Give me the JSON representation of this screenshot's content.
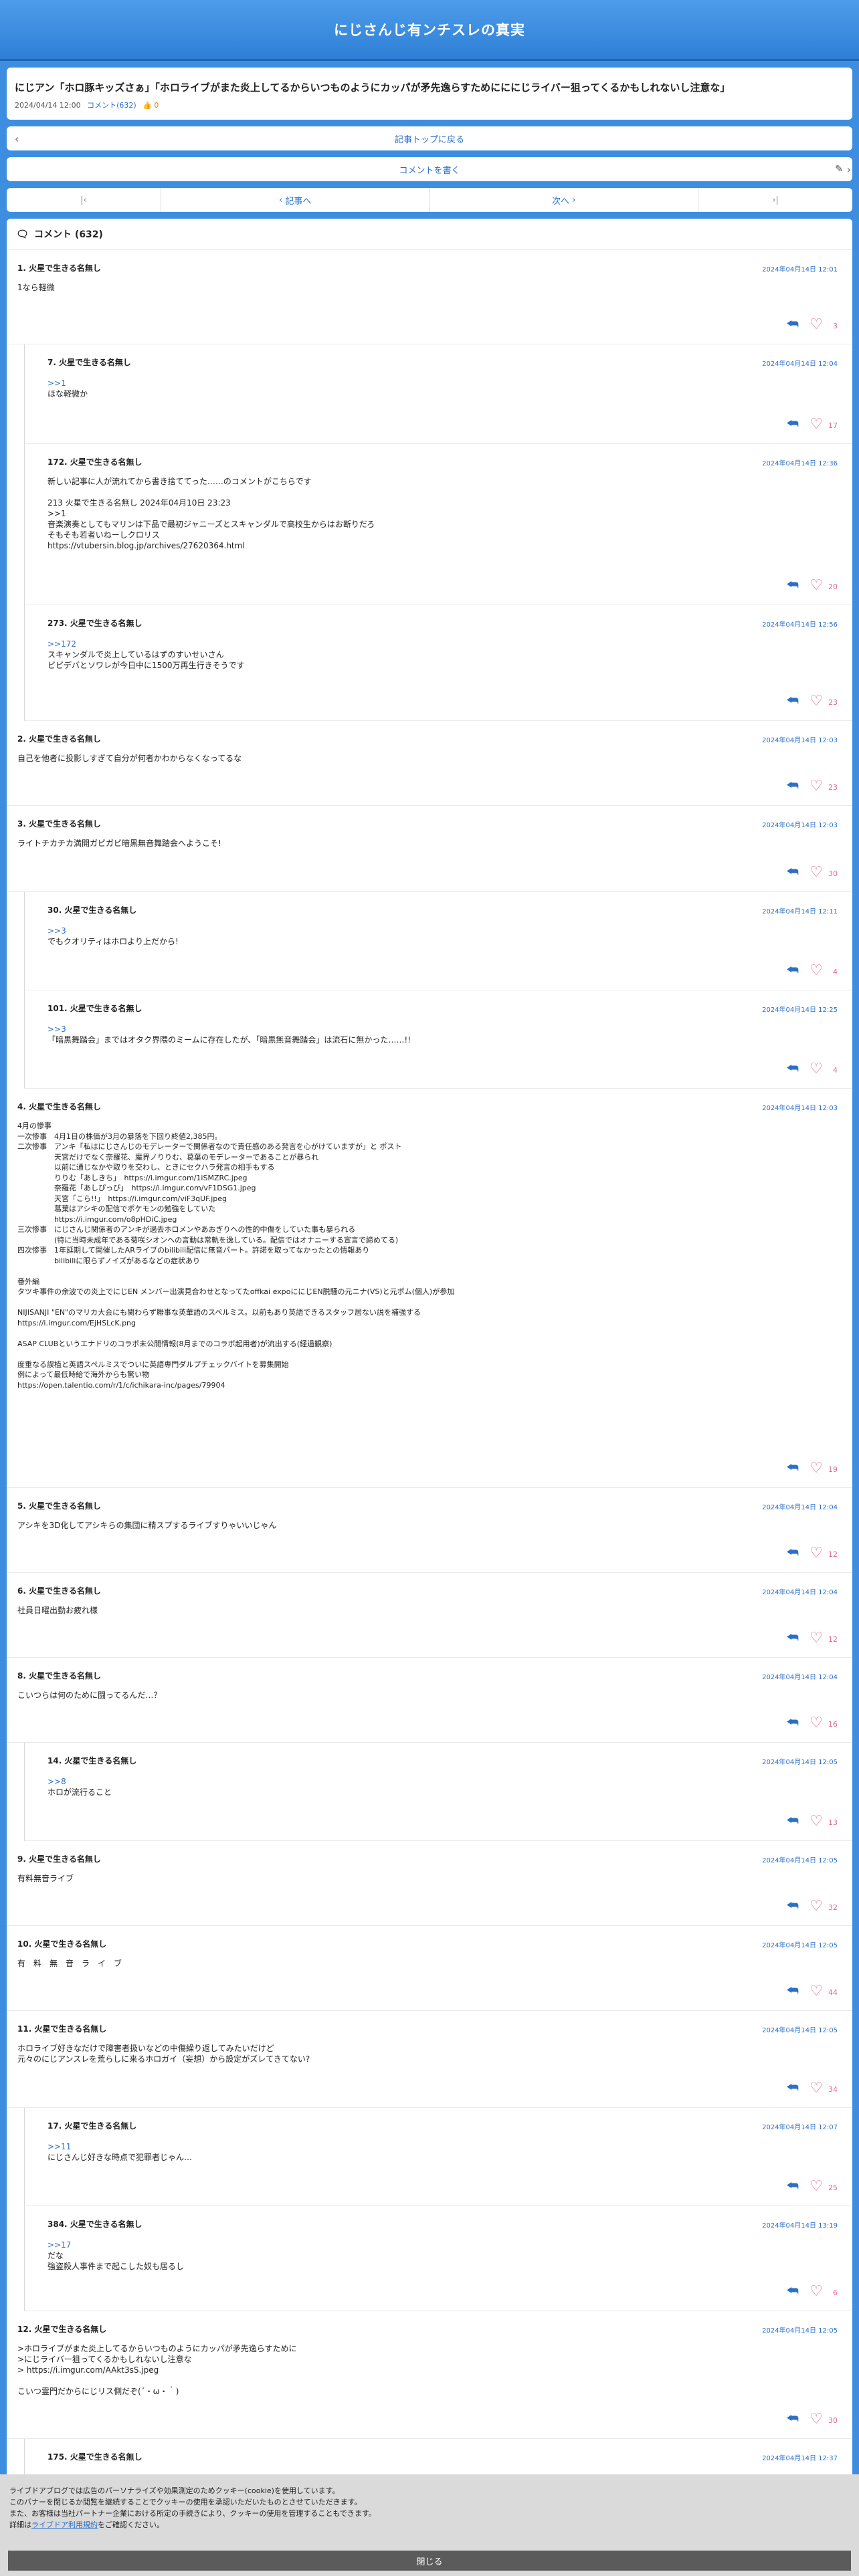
{
  "header": {
    "title": "にじさんじ有ンチスレの真実"
  },
  "article": {
    "title": "にじアン「ホロ豚キッズさぁ」「ホロライブがまた炎上してるからいつものようにカッパが矛先逸らすためにににじライバー狙ってくるかもしれないし注意な」",
    "date": "2024/04/14 12:00",
    "comments": "コメント(632)",
    "likes": "👍 0"
  },
  "nav": {
    "back": "記事トップに戻る",
    "write": "コメントを書く",
    "prev": "記事へ",
    "next": "次へ"
  },
  "comments_header": "コメント (632)",
  "comments": [
    {
      "name": "1. 火星で生きる名無し",
      "date": "2024年04月14日 12:01",
      "body": "1なら軽微",
      "count": "3"
    },
    {
      "name": "7. 火星で生きる名無し",
      "date": "2024年04月14日 12:04",
      "body_link": ">>1",
      "body": "ほな軽微か",
      "count": "17"
    },
    {
      "name": "172. 火星で生きる名無し",
      "date": "2024年04月14日 12:36",
      "body": "新しい記事に人が流れてから書き捨ててった……のコメントがこちらです\n\n213 火星で生きる名無し 2024年04月10日 23:23\n>>1\n音楽演奏としてもマリンは下品で最初ジャニーズとスキャンダルで高校生からはお断りだろ\nそもそも若者いねーしクロリス\nhttps://vtubersin.blog.jp/archives/27620364.html",
      "count": "20"
    },
    {
      "name": "273. 火星で生きる名無し",
      "date": "2024年04月14日 12:56",
      "body_link": ">>172",
      "body": "スキャンダルで炎上しているはずのすいせいさん\nビビデバとソワレが今日中に1500万再生行きそうです",
      "count": "23"
    },
    {
      "name": "2. 火星で生きる名無し",
      "date": "2024年04月14日 12:03",
      "body": "自己を他者に投影しすぎて自分が何者かわからなくなってるな",
      "count": "23"
    },
    {
      "name": "3. 火星で生きる名無し",
      "date": "2024年04月14日 12:03",
      "body": "ライトチカチカ満開ガビガビ暗黒無音舞踏会へようこそ!",
      "count": "30"
    },
    {
      "name": "30. 火星で生きる名無し",
      "date": "2024年04月14日 12:11",
      "body_link": ">>3",
      "body": "でもクオリティはホロより上だから!",
      "count": "4"
    },
    {
      "name": "101. 火星で生きる名無し",
      "date": "2024年04月14日 12:25",
      "body_link": ">>3",
      "body": "「暗黒舞踏会」まではオタク界隈のミームに存在したが、「暗黒無音舞踏会」は流石に無かった……!!",
      "count": "4"
    },
    {
      "name": "4. 火星で生きる名無し",
      "date": "2024年04月14日 12:03",
      "body": "4月の惨事\n一次惨事　4月1日の株価が3月の暴落を下回り終値2,385円。\n二次惨事　アンキ「私はにじさんじのモデレーターで関係者なので責任感のある発言を心がけていますが」と ポスト\n　　　　　天宮だけでなく奈羅花、魔界ノりりむ、葛葉のモデレーターであることが暴られ\n　　　　　以前に通じなかや取りを交わし、ときにセクハラ発言の相手もする\n　　　　　りりむ「あしきち」　https://i.imgur.com/1iSMZRC.jpeg\n　　　　　奈羅花「あしぴっぴ」　https://i.imgur.com/vF1DSG1.jpeg\n　　　　　天宮「こら!!」　https://i.imgur.com/viF3qUF.jpeg\n　　　　　葛葉はアシキの配信でポケモンの勉強をしていた\n　　　　　https://i.imgur.com/o8pHDiC.jpeg\n三次惨事　にじさんじ関係者のアンキが過去ホロメンやあおぎりへの性的中傷をしていた事も暴られる\n　　　　　(特に当時未成年である菊咲シオンへの言動は常軌を逸している。配信ではオナニーする宣言で締めてる)\n四次惨事　1年延期して開催したARライブのbilibili配信に無音パート。許諾を取ってなかったとの情報あり\n　　　　　bilibiliに限らずノイズがあるなどの症状あり\n\n番外編\nタツキ事件の余波での炎上でにじEN メンバー出演見合わせとなってたoffkai expoににじEN脱騒の元ニナ(VS)と元ポム(個人)が参加\n\nNIJISANJI \"EN\"のマリカ大会にも関わらず聯事な英華語のスペルミス。以前もあり英語できるスタッフ居ない説を補強する\nhttps://i.imgur.com/EjHSLcK.png\n\nASAP CLUBというエナドリのコラボ未公開情報(8月までのコラボ起用者)が流出する(経過観察)\n\n度重なる誤植と英語スペルミスでついに英語専門ダルプチェックバイトを募集開始\n例によって最低時給で海外からも驚い物\nhttps://open.talentio.com/r/1/c/ichikara-inc/pages/79904",
      "count": "19"
    },
    {
      "name": "5. 火星で生きる名無し",
      "date": "2024年04月14日 12:04",
      "body": "アシキを3D化してアシキらの集団に精スプするライブすりゃいいじゃん",
      "count": "12"
    },
    {
      "name": "6. 火星で生きる名無し",
      "date": "2024年04月14日 12:04",
      "body": "社員日曜出勤お疲れ様",
      "count": "12"
    },
    {
      "name": "8. 火星で生きる名無し",
      "date": "2024年04月14日 12:04",
      "body": "こいつらは何のために闘ってるんだ…？",
      "count": "16"
    },
    {
      "name": "14. 火星で生きる名無し",
      "date": "2024年04月14日 12:05",
      "body_link": ">>8",
      "body": "ホロが流行ること",
      "count": "13"
    },
    {
      "name": "9. 火星で生きる名無し",
      "date": "2024年04月14日 12:05",
      "body": "有料無音ライブ",
      "count": "32"
    },
    {
      "name": "10. 火星で生きる名無し",
      "date": "2024年04月14日 12:05",
      "body": "有　料　無　音　ラ　イ　ブ",
      "count": "44"
    },
    {
      "name": "11. 火星で生きる名無し",
      "date": "2024年04月14日 12:05",
      "body": "ホロライブ好きなだけで障害者扱いなどの中傷繰り返してみたいだけど\n元々のにじアンスレを荒らしに来るホロガイ（妄想）から設定がズレてきてない?",
      "count": "34"
    },
    {
      "name": "17. 火星で生きる名無し",
      "date": "2024年04月14日 12:07",
      "body_link": ">>11",
      "body": "にじさんじ好きな時点で犯罪者じゃん…",
      "count": "25"
    },
    {
      "name": "384. 火星で生きる名無し",
      "date": "2024年04月14日 13:19",
      "body_link": ">>17",
      "body": "だな\n強盗殺人事件まで起こした奴も居るし",
      "count": "6"
    },
    {
      "name": "12. 火星で生きる名無し",
      "date": "2024年04月14日 12:05",
      "body": ">ホロライブがまた炎上してるからいつものようにカッパが矛先逸らすために\n>にじライバー狙ってくるかもしれないし注意な\n> https://i.imgur.com/AAkt3sS.jpeg\n\nこいつ霊門だからにじリス側だぞ(´・ω・｀)",
      "count": "30"
    },
    {
      "name": "175. 火星で生きる名無し",
      "date": "2024年04月14日 12:37",
      "body": "",
      "count": ""
    }
  ],
  "cookie": {
    "line1": "ライブドアブログでは広告のパーソナライズや効果測定のためクッキー(cookie)を使用しています。",
    "line2": "このバナーを閉じるか閲覧を継続することでクッキーの使用を承認いただいたものとさせていただきます。",
    "line3": "また、お客様は当社パートナー企業における所定の手続きにより、クッキーの使用を管理することもできます。",
    "line4_pre": "詳細は",
    "line4_link": "ライブドア利用規約",
    "line4_post": "をご確認ください。",
    "close": "閉じる"
  }
}
